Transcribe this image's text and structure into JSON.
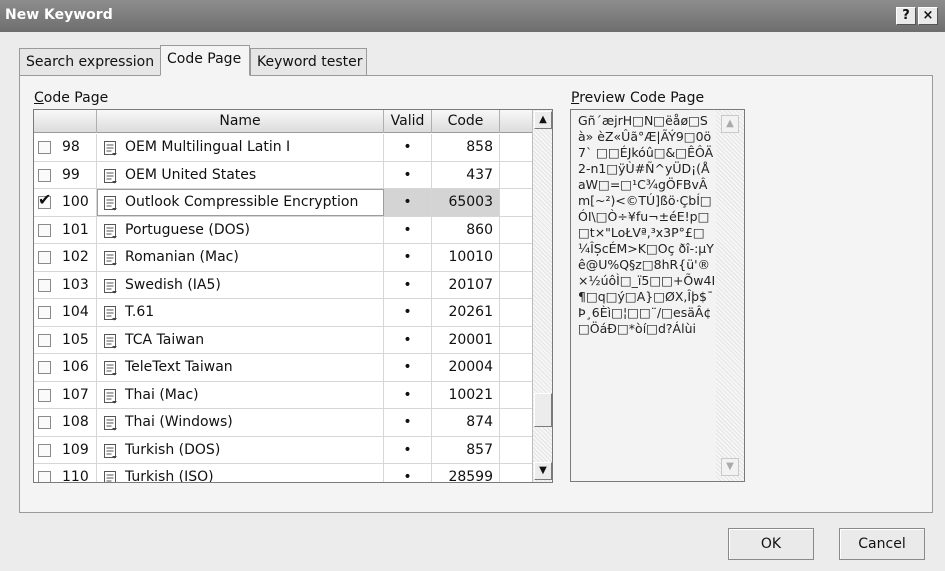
{
  "window": {
    "title": "New Keyword",
    "help_button": "?",
    "close_button": "×"
  },
  "tabs": [
    {
      "label": "Search expression",
      "active": false
    },
    {
      "label": "Code Page",
      "active": true
    },
    {
      "label": "Keyword tester",
      "active": false
    }
  ],
  "code_page_group": {
    "label_prefix": "C",
    "label_rest": "ode Page",
    "columns": [
      "",
      "Name",
      "Valid",
      "Code"
    ],
    "rows": [
      {
        "checked": false,
        "num": "98",
        "name": "OEM Multilingual Latin I",
        "valid": "•",
        "code": "858"
      },
      {
        "checked": false,
        "num": "99",
        "name": "OEM United States",
        "valid": "•",
        "code": "437"
      },
      {
        "checked": true,
        "num": "100",
        "name": "Outlook Compressible Encryption",
        "valid": "•",
        "code": "65003"
      },
      {
        "checked": false,
        "num": "101",
        "name": "Portuguese (DOS)",
        "valid": "•",
        "code": "860"
      },
      {
        "checked": false,
        "num": "102",
        "name": "Romanian (Mac)",
        "valid": "•",
        "code": "10010"
      },
      {
        "checked": false,
        "num": "103",
        "name": "Swedish (IA5)",
        "valid": "•",
        "code": "20107"
      },
      {
        "checked": false,
        "num": "104",
        "name": "T.61",
        "valid": "•",
        "code": "20261"
      },
      {
        "checked": false,
        "num": "105",
        "name": "TCA Taiwan",
        "valid": "•",
        "code": "20001"
      },
      {
        "checked": false,
        "num": "106",
        "name": "TeleText Taiwan",
        "valid": "•",
        "code": "20004"
      },
      {
        "checked": false,
        "num": "107",
        "name": "Thai (Mac)",
        "valid": "•",
        "code": "10021"
      },
      {
        "checked": false,
        "num": "108",
        "name": "Thai (Windows)",
        "valid": "•",
        "code": "874"
      },
      {
        "checked": false,
        "num": "109",
        "name": "Turkish (DOS)",
        "valid": "•",
        "code": "857"
      },
      {
        "checked": false,
        "num": "110",
        "name": "Turkish (ISO)",
        "valid": "•",
        "code": "28599"
      }
    ],
    "scroll_up": "▲",
    "scroll_down": "▼"
  },
  "preview_group": {
    "label_prefix": "P",
    "label_rest": "review Code Page",
    "text": "Gñ´æjrH□N□ëåø□Sà» èZ«Ûã°Æ|ÃÝ9□0ö7` □□ÉJkóû□&□ÊÔÄ2-n1□ÿÙ#Ñ^yÜD¡(ÅaW□=□¹C¾gÖFBvÂm[~²)<©TÚ]ßö·ÇbÍ□ÓI\\□Ò÷¥fu¬±éE!p□□t×\"LoŁVª,³x3P°£□¼ÎȘcÉM>K□Oç ðî-:µYê@U%Q§z□8hR{ü'®×½úôÌ□_ï5□□+Õw4I¶□q□ý□A}□ØX,Îþ$¯Þ¸6Èì□¦□□¨/□esäÂ¢□ÖáÐ□*òí□d?Álùi",
    "scroll_up": "▲",
    "scroll_down": "▼"
  },
  "footer": {
    "ok_label": "OK",
    "cancel_label": "Cancel"
  }
}
